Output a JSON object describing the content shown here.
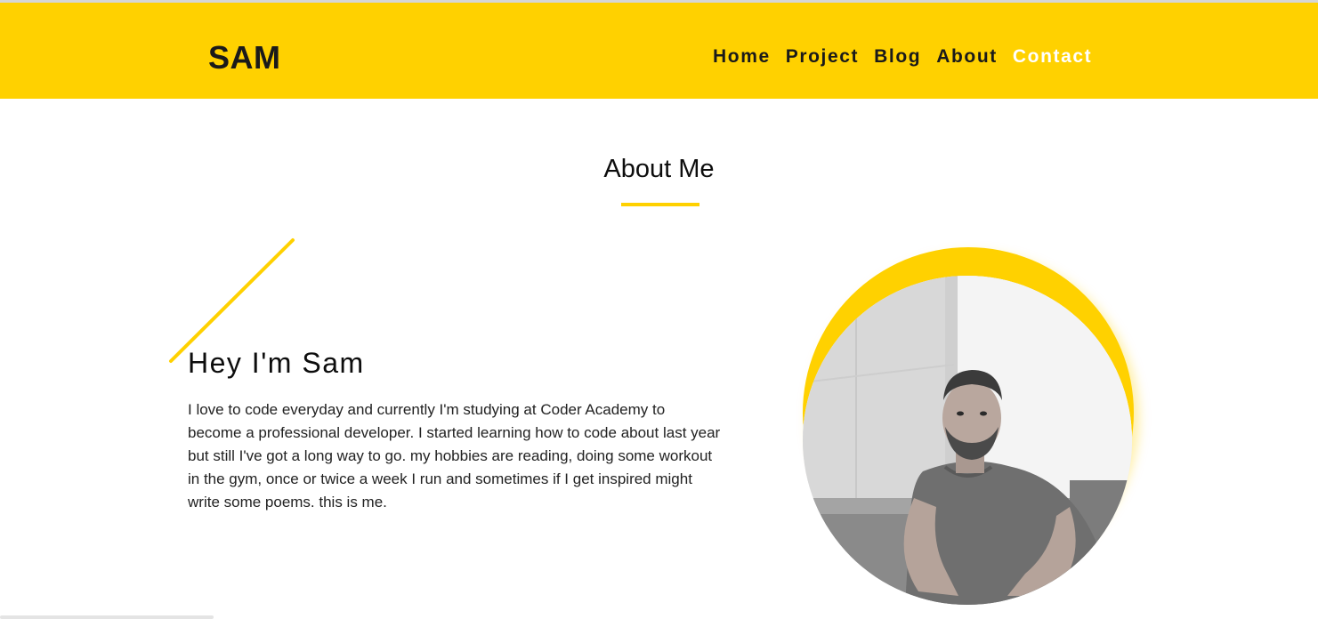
{
  "header": {
    "logo": "SAM",
    "nav": [
      {
        "label": "Home",
        "active": false
      },
      {
        "label": "Project",
        "active": false
      },
      {
        "label": "Blog",
        "active": false
      },
      {
        "label": "About",
        "active": false
      },
      {
        "label": "Contact",
        "active": true
      }
    ]
  },
  "about": {
    "title": "About Me",
    "greeting": "Hey I'm Sam",
    "bio": "I love to code everyday and currently I'm studying at Coder Academy to become a professional developer. I started learning how to code about last year but still I've got a long way to go. my hobbies are reading, doing some workout in the gym, once or twice a week I run and sometimes if I get inspired might write some poems. this is me."
  },
  "colors": {
    "accent": "#ffd100",
    "text": "#111111",
    "background": "#ffffff"
  }
}
